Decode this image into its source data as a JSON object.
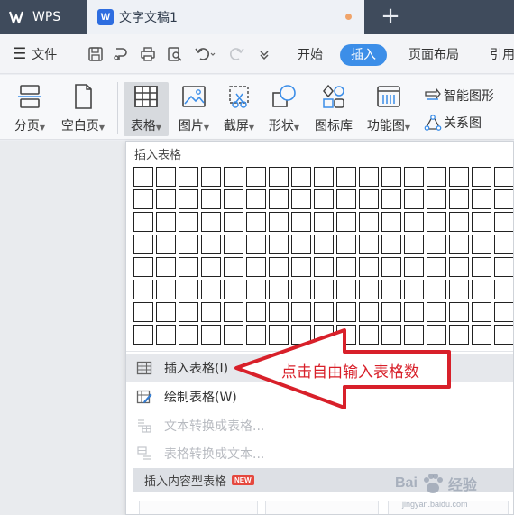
{
  "titlebar": {
    "app_name": "WPS",
    "document_tab": "文字文稿1",
    "word_icon_letter": "W",
    "new_tab_symbol": "+"
  },
  "menubar": {
    "file_label": "文件",
    "tabs": [
      "开始",
      "插入",
      "页面布局",
      "引用"
    ],
    "active_tab": "插入"
  },
  "ribbon": {
    "buttons": [
      "分页",
      "空白页",
      "表格",
      "图片",
      "截屏",
      "形状",
      "图标库",
      "功能图"
    ],
    "small_buttons": [
      "智能图形",
      "关系图"
    ]
  },
  "dropdown": {
    "title": "插入表格",
    "grid": {
      "columns": 17,
      "rows": 8
    },
    "items": [
      {
        "label": "插入表格(I)",
        "enabled": true,
        "hovered": true
      },
      {
        "label": "绘制表格(W)",
        "enabled": true
      },
      {
        "label": "文本转换成表格...",
        "enabled": false
      },
      {
        "label": "表格转换成文本...",
        "enabled": false
      }
    ],
    "content_tables_label": "插入内容型表格",
    "new_badge": "NEW"
  },
  "annotation": {
    "text": "点击自由输入表格数",
    "color": "#d8202a"
  },
  "watermark": {
    "brand_left": "Bai",
    "brand_right": "经验",
    "url": "jingyan.baidu.com"
  },
  "colors": {
    "titlebar_bg": "#3f4b5c",
    "accent": "#3c8ee8",
    "arrow": "#d8202a"
  }
}
